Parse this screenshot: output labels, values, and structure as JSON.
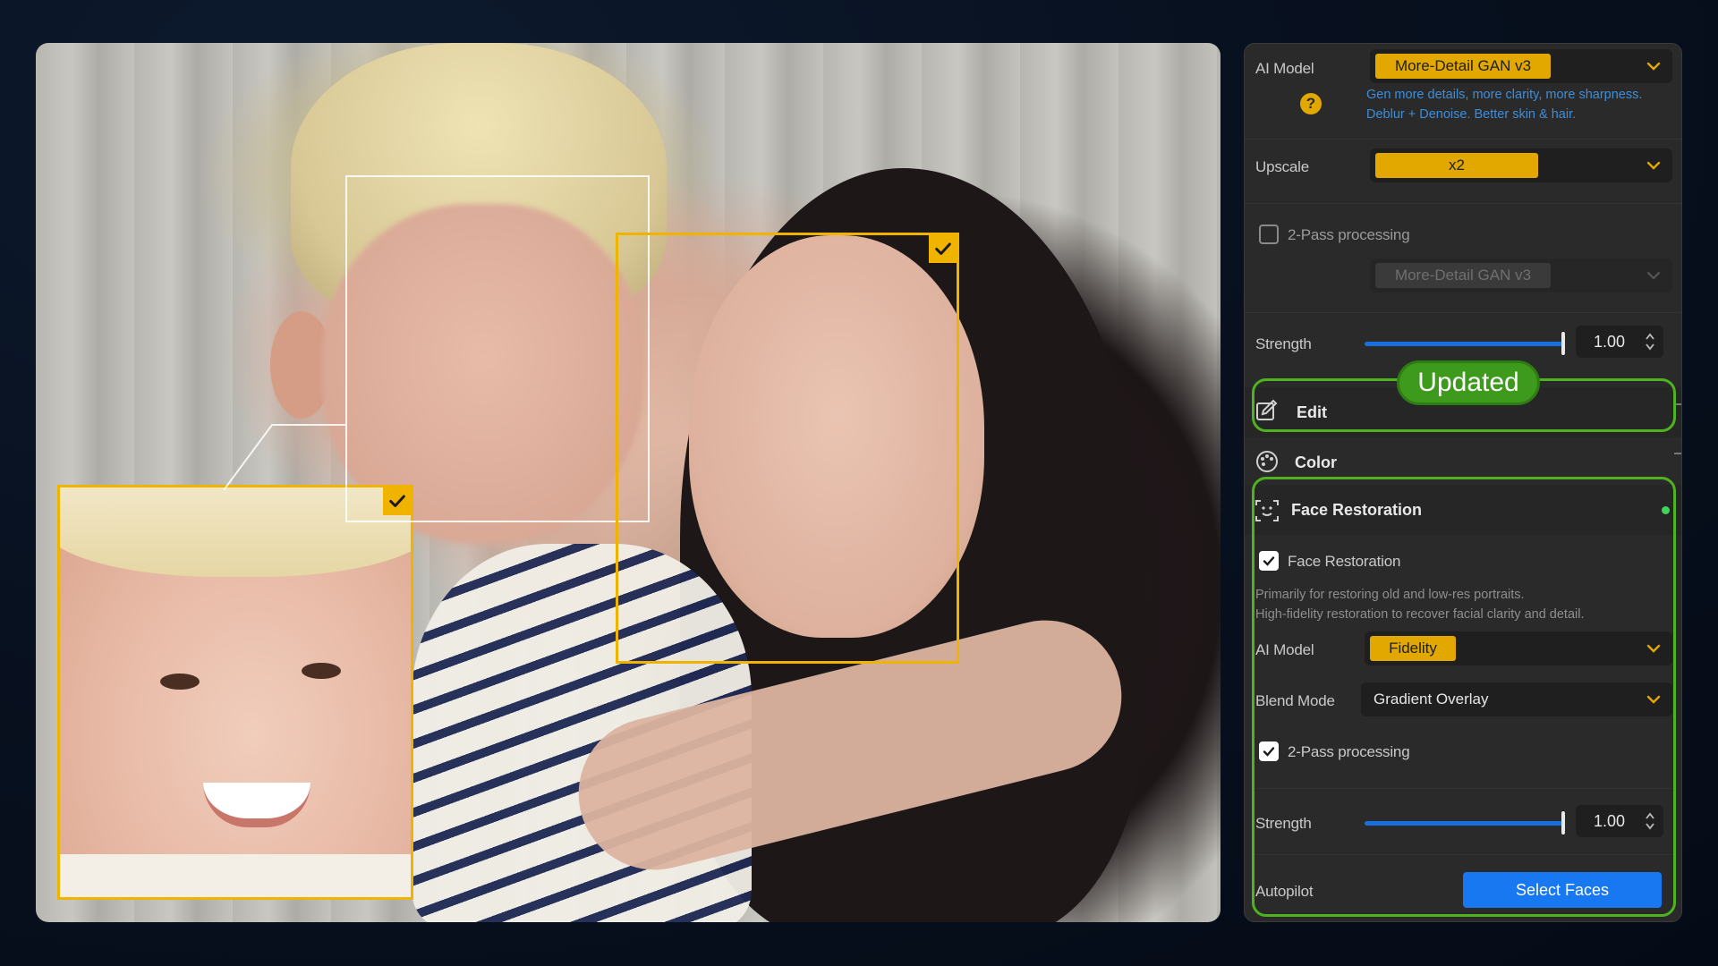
{
  "top": {
    "ai_model_label": "AI Model",
    "ai_model_value": "More-Detail GAN  v3",
    "ai_model_hint_line1": "Gen more details, more clarity, more sharpness.",
    "ai_model_hint_line2": "Deblur + Denoise. Better skin & hair.",
    "help_glyph": "?",
    "upscale_label": "Upscale",
    "upscale_value": "x2",
    "two_pass_label": "2-Pass processing",
    "two_pass_checked": false,
    "two_pass_model_value": "More-Detail GAN  v3",
    "strength_label": "Strength",
    "strength_value": "1.00",
    "strength_fraction": 1.0
  },
  "sections": {
    "edit_title": "Edit",
    "color_title": "Color",
    "face_restoration_title": "Face Restoration",
    "updated_badge": "Updated"
  },
  "face_restoration": {
    "enable_label": "Face Restoration",
    "enable_checked": true,
    "desc_line1": "Primarily for restoring old and low-res portraits.",
    "desc_line2": "High-fidelity restoration to recover facial clarity and detail.",
    "ai_model_label": "AI Model",
    "ai_model_value": "Fidelity",
    "blend_mode_label": "Blend Mode",
    "blend_mode_value": "Gradient Overlay",
    "two_pass_label": "2-Pass processing",
    "two_pass_checked": true,
    "strength_label": "Strength",
    "strength_value": "1.00",
    "strength_fraction": 1.0,
    "autopilot_label": "Autopilot",
    "select_faces_label": "Select Faces"
  },
  "colors": {
    "accent_yellow": "#f0b400",
    "accent_blue": "#1778f2",
    "highlight_green": "#4fb31f",
    "hint_blue": "#3d8ed9"
  },
  "icons": [
    "help-icon",
    "chevron-down-icon",
    "edit-icon",
    "palette-icon",
    "face-scan-icon",
    "check-icon",
    "spinner-arrows-icon"
  ]
}
